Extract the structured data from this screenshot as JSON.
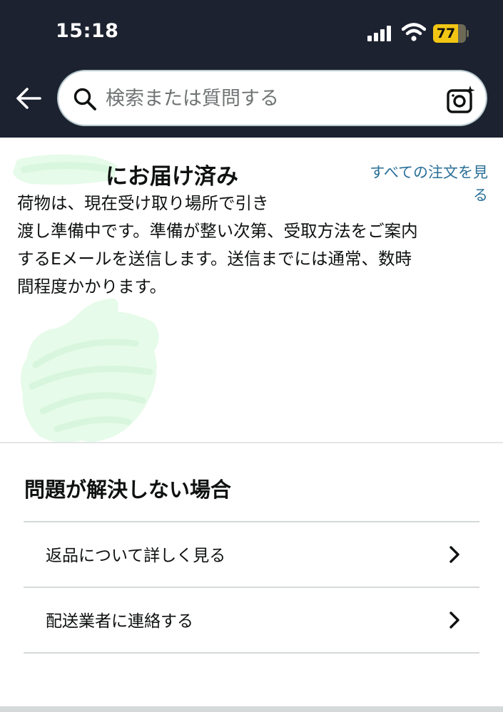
{
  "status_bar": {
    "time": "15:18",
    "battery_level": "77"
  },
  "search": {
    "placeholder": "検索または質問する"
  },
  "delivery": {
    "title_visible": "にお届け済み",
    "all_orders_link_line1": "すべての注文を見",
    "all_orders_link_line2": "る",
    "description_lines": [
      "荷物は、現在受け取り場所で引き",
      "渡し準備中です。準備が整い次第、受取方法をご案内",
      "するEメールを送信します。送信までには通常、数時",
      "間程度かかります。"
    ]
  },
  "help": {
    "title": "問題が解決しない場合",
    "items": [
      {
        "label": "返品について詳しく見る"
      },
      {
        "label": "配送業者に連絡する"
      }
    ]
  },
  "colors": {
    "header_bg": "#1c2230",
    "link": "#2a6f97",
    "battery": "#f3c614",
    "redaction": "#e6fbe9"
  }
}
